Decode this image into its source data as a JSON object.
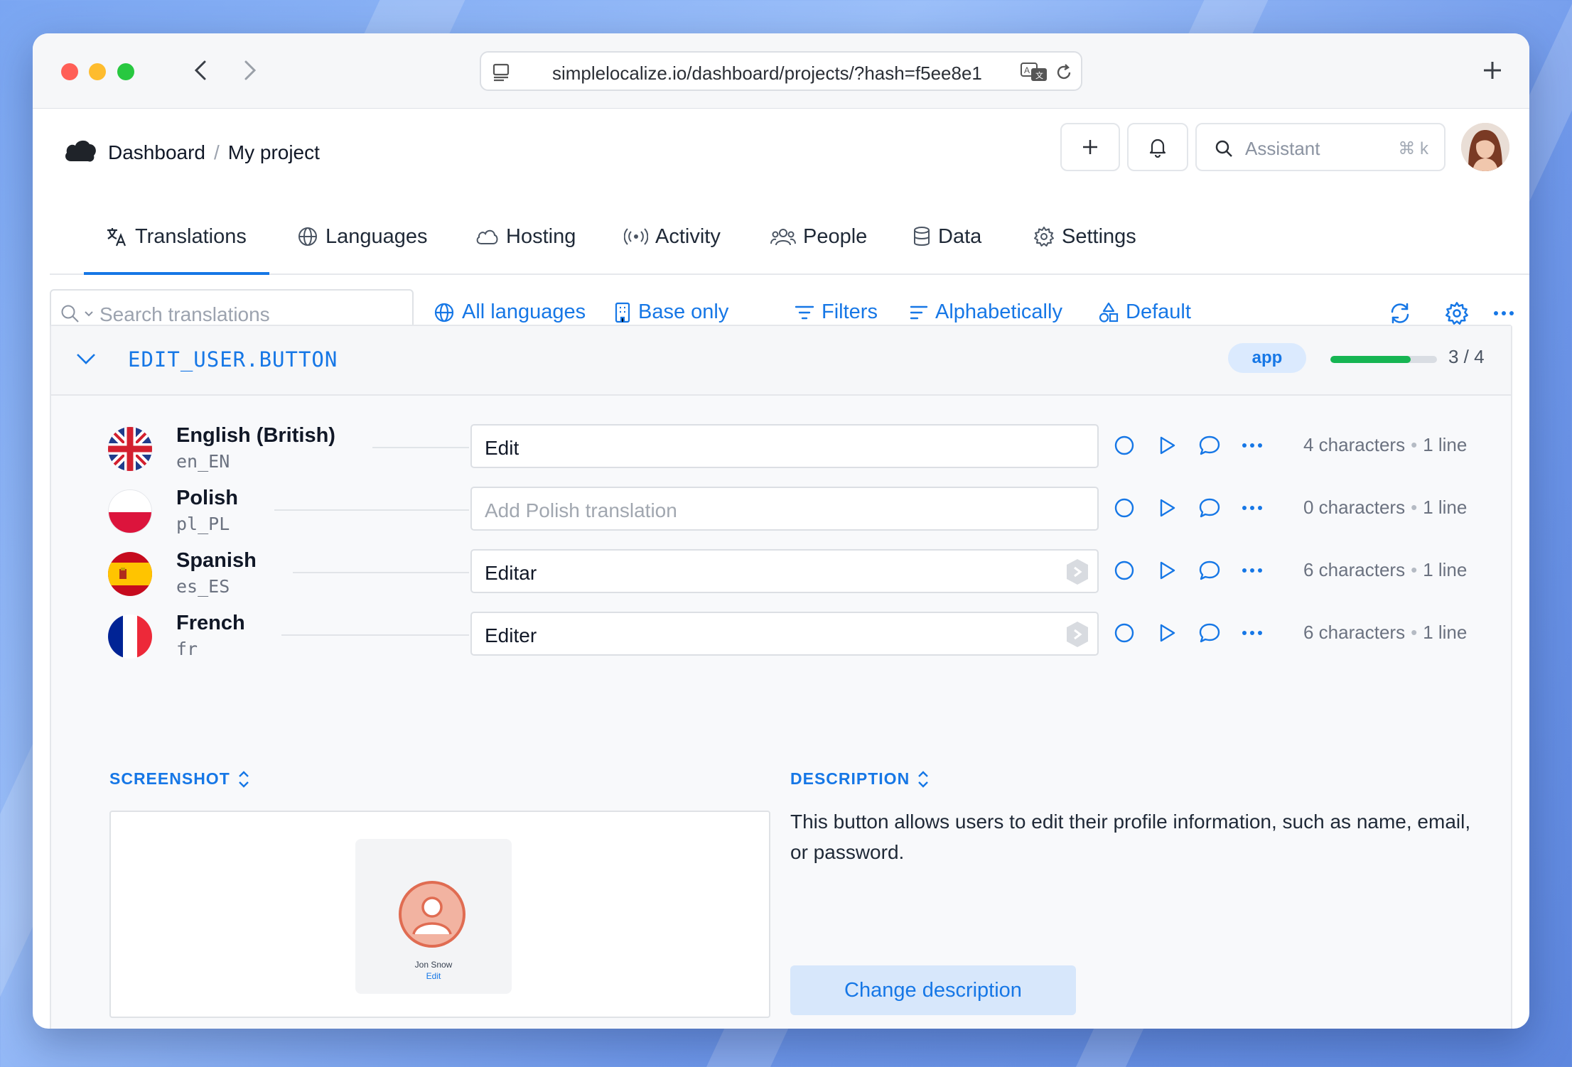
{
  "browser": {
    "url": "simplelocalize.io/dashboard/projects/?hash=f5ee8e1"
  },
  "header": {
    "breadcrumb_root": "Dashboard",
    "breadcrumb_sep": "/",
    "breadcrumb_current": "My project",
    "assistant_label": "Assistant",
    "assistant_shortcut": "⌘ k"
  },
  "tabs": [
    {
      "label": "Translations",
      "icon": "translate-icon",
      "active": true
    },
    {
      "label": "Languages",
      "icon": "globe-icon"
    },
    {
      "label": "Hosting",
      "icon": "cloud-icon"
    },
    {
      "label": "Activity",
      "icon": "broadcast-icon"
    },
    {
      "label": "People",
      "icon": "people-icon"
    },
    {
      "label": "Data",
      "icon": "database-icon"
    },
    {
      "label": "Settings",
      "icon": "gear-icon"
    }
  ],
  "toolbar": {
    "search_placeholder": "Search translations",
    "all_languages": "All languages",
    "base_only": "Base only",
    "filters": "Filters",
    "sort": "Alphabetically",
    "view": "Default"
  },
  "key": {
    "name": "EDIT_USER.BUTTON",
    "tag": "app",
    "progress_text": "3 / 4",
    "progress_fraction": 0.75
  },
  "translations": [
    {
      "language": "English (British)",
      "code": "en_EN",
      "value": "Edit",
      "placeholder": "",
      "chars": "4 characters",
      "lines": "1 line",
      "machine": false
    },
    {
      "language": "Polish",
      "code": "pl_PL",
      "value": "",
      "placeholder": "Add Polish translation",
      "chars": "0 characters",
      "lines": "1 line",
      "machine": false
    },
    {
      "language": "Spanish",
      "code": "es_ES",
      "value": "Editar",
      "placeholder": "",
      "chars": "6 characters",
      "lines": "1 line",
      "machine": true
    },
    {
      "language": "French",
      "code": "fr",
      "value": "Editer",
      "placeholder": "",
      "chars": "6 characters",
      "lines": "1 line",
      "machine": true
    }
  ],
  "screenshot": {
    "label": "SCREENSHOT",
    "user_name": "Jon Snow",
    "user_action": "Edit"
  },
  "description": {
    "label": "DESCRIPTION",
    "text": "This button allows users to edit their profile information, such as name, email, or password.",
    "button": "Change description"
  },
  "colors": {
    "accent": "#1677e6",
    "progress": "#16b553"
  }
}
